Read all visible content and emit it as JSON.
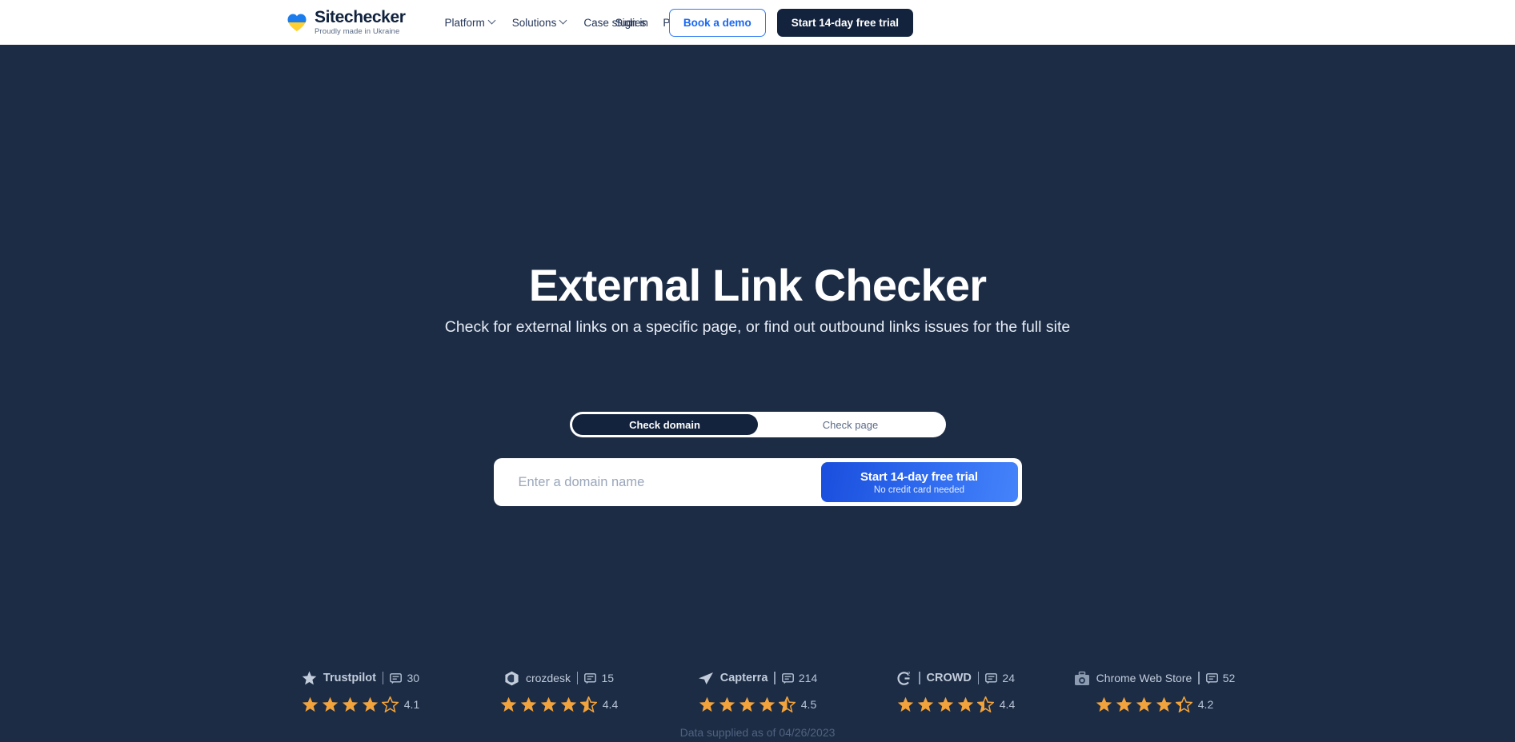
{
  "header": {
    "logo": {
      "name": "Sitechecker",
      "tagline": "Proudly made in Ukraine",
      "icon": "ukraine-heart-icon"
    },
    "nav": [
      {
        "label": "Platform",
        "has_dropdown": true
      },
      {
        "label": "Solutions",
        "has_dropdown": true
      },
      {
        "label": "Case studies",
        "has_dropdown": false
      },
      {
        "label": "Pricing",
        "has_dropdown": false
      }
    ],
    "sign_in": "Sign in",
    "book_demo": "Book a demo",
    "start_trial": "Start 14-day free trial"
  },
  "hero": {
    "title": "External Link Checker",
    "subtitle": "Check for external links on a specific page, or find out outbound links issues for the full site",
    "toggle": {
      "options": [
        "Check domain",
        "Check page"
      ],
      "selected": "Check domain"
    },
    "search": {
      "placeholder": "Enter a domain name",
      "value": "",
      "cta_primary": "Start 14-day free trial",
      "cta_secondary": "No credit card needed"
    }
  },
  "social_proof": {
    "badges": [
      {
        "name": "Trustpilot",
        "icon": "trustpilot-star-icon",
        "reviews": "30",
        "rating": "4.1",
        "stars_full": 4,
        "stars_half": 0,
        "stars_empty": 1
      },
      {
        "name": "crozdesk",
        "icon": "crozdesk-icon",
        "reviews": "15",
        "rating": "4.4",
        "stars_full": 4,
        "stars_half": 1,
        "stars_empty": 0
      },
      {
        "name": "Capterra",
        "icon": "capterra-icon",
        "reviews": "214",
        "rating": "4.5",
        "stars_full": 4,
        "stars_half": 1,
        "stars_empty": 0
      },
      {
        "name": "CROWD",
        "icon": "g2-crowd-icon",
        "reviews": "24",
        "rating": "4.4",
        "stars_full": 4,
        "stars_half": 1,
        "stars_empty": 0
      },
      {
        "name": "Chrome Web Store",
        "icon": "chrome-web-store-icon",
        "reviews": "52",
        "rating": "4.2",
        "stars_full": 4,
        "stars_half": 1,
        "stars_empty": 0
      }
    ],
    "footnote": "Data supplied as of 04/26/2023"
  },
  "colors": {
    "hero_bg_dark": "#1b2a42",
    "hero_bg_light": "#354a69",
    "accent_blue": "#1868f4",
    "cta_gradient_start": "#1a4edd",
    "cta_gradient_end": "#4583fb",
    "dark_navy": "#13233d",
    "star_gold": "#f2a33c",
    "logo_blue": "#1b7ced",
    "logo_yellow": "#ffd02e"
  }
}
